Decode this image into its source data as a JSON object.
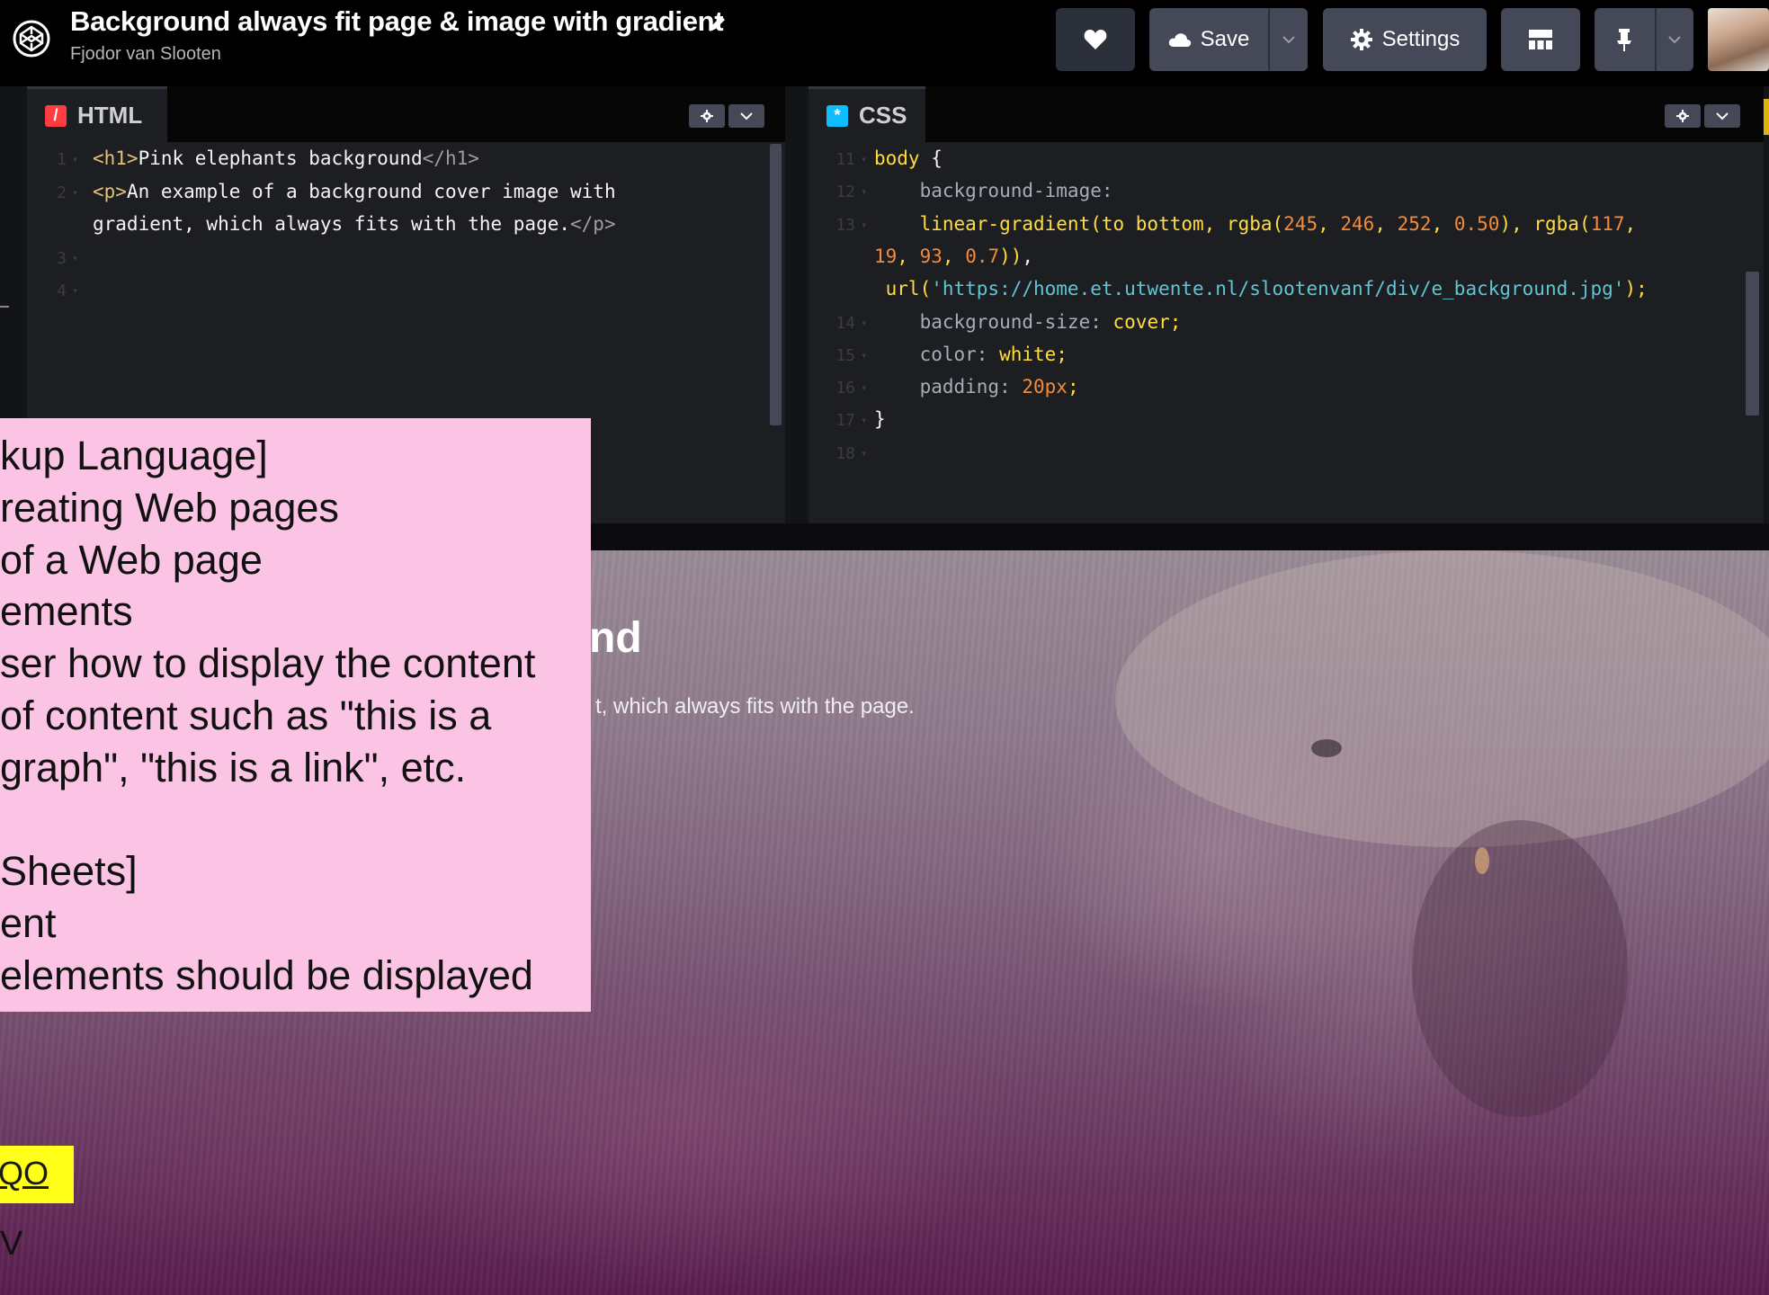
{
  "header": {
    "title": "Background always fit page & image with gradient",
    "author": "Fjodor van Slooten",
    "save_label": "Save",
    "settings_label": "Settings"
  },
  "html_panel": {
    "label": "HTML",
    "lines": [
      {
        "n": "1",
        "parts": [
          [
            "tag",
            "<h1>"
          ],
          [
            "white",
            "Pink elephants background"
          ],
          [
            "tagc",
            "</h1>"
          ]
        ]
      },
      {
        "n": "2",
        "parts": [
          [
            "tag",
            "<p>"
          ],
          [
            "white",
            "An example of a background cover image with"
          ]
        ]
      },
      {
        "n": "",
        "parts": [
          [
            "white",
            "gradient, which always fits with the page."
          ],
          [
            "tagc",
            "</p>"
          ]
        ]
      },
      {
        "n": "3",
        "parts": []
      },
      {
        "n": "4",
        "parts": []
      }
    ]
  },
  "css_panel": {
    "label": "CSS",
    "lines": [
      {
        "n": "11",
        "parts": [
          [
            "sel",
            "body "
          ],
          [
            "white",
            "{"
          ]
        ]
      },
      {
        "n": "12",
        "parts": [
          [
            "prop",
            "    background-image:"
          ]
        ]
      },
      {
        "n": "13",
        "parts": [
          [
            "val",
            "    linear-gradient(to bottom, rgba("
          ],
          [
            "num",
            "245"
          ],
          [
            "val",
            ", "
          ],
          [
            "num",
            "246"
          ],
          [
            "val",
            ", "
          ],
          [
            "num",
            "252"
          ],
          [
            "val",
            ", "
          ],
          [
            "num",
            "0.50"
          ],
          [
            "val",
            "), rgba("
          ],
          [
            "num",
            "117"
          ],
          [
            "val",
            ","
          ]
        ]
      },
      {
        "n": "",
        "parts": [
          [
            "num",
            "19"
          ],
          [
            "val",
            ", "
          ],
          [
            "num",
            "93"
          ],
          [
            "val",
            ", "
          ],
          [
            "num",
            "0.7"
          ],
          [
            "val",
            "))"
          ],
          [
            "white",
            ","
          ]
        ]
      },
      {
        "n": "",
        "parts": [
          [
            "val",
            " url("
          ],
          [
            "str",
            "'https://home.et.utwente.nl/slootenvanf/div/e_background.jpg'"
          ],
          [
            "val",
            ");"
          ]
        ]
      },
      {
        "n": "14",
        "parts": [
          [
            "prop",
            "    background-size: "
          ],
          [
            "val",
            "cover;"
          ]
        ]
      },
      {
        "n": "15",
        "parts": [
          [
            "prop",
            "    color: "
          ],
          [
            "val",
            "white;"
          ]
        ]
      },
      {
        "n": "16",
        "parts": [
          [
            "prop",
            "    padding: "
          ],
          [
            "num",
            "20px"
          ],
          [
            "val",
            ";"
          ]
        ]
      },
      {
        "n": "17",
        "parts": [
          [
            "white",
            "}"
          ]
        ]
      },
      {
        "n": "18",
        "parts": []
      }
    ]
  },
  "preview": {
    "heading_fragment": "nd",
    "paragraph_fragment": "t, which always fits with the page."
  },
  "overlay": {
    "pink_lines": [
      "kup Language]",
      "reating Web pages",
      " of a Web page",
      "ements",
      "ser how to display the content",
      "of content such as \"this is a",
      "graph\", \"this is a link\", etc.",
      "",
      "Sheets]",
      "ent",
      "elements should be displayed"
    ],
    "yellow_link": "QO",
    "bottom_fragment": "V"
  },
  "colors": {
    "html_badge": "#ff3c41",
    "css_badge": "#0ebeff",
    "pink_overlay": "#fcc4e4",
    "yellow_overlay": "#ffff1a"
  }
}
